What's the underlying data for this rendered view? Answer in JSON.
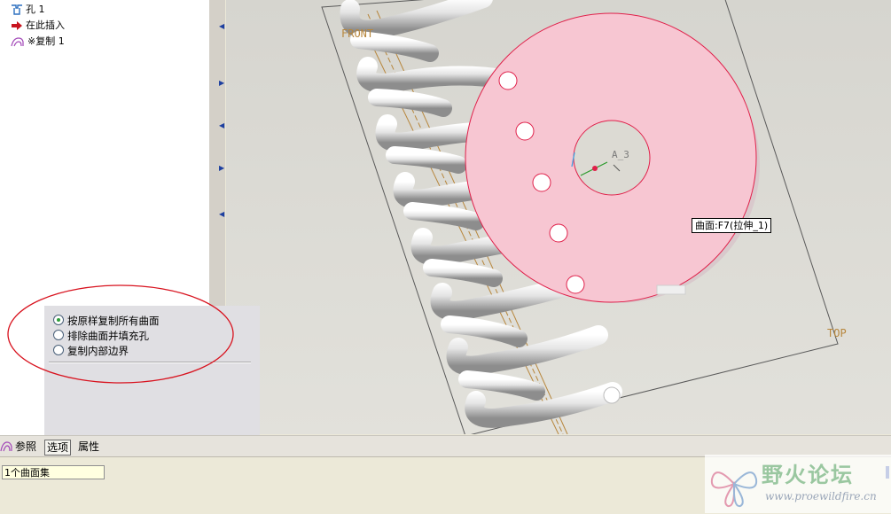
{
  "model_tree": {
    "items": [
      {
        "label": "孔 1",
        "icon": "hole-feature-icon"
      },
      {
        "label": "在此插入",
        "icon": "insert-here-arrow-icon"
      },
      {
        "label": "※复制 1",
        "icon": "copy-surface-icon"
      }
    ]
  },
  "options_panel": {
    "options": [
      {
        "label": "按原样复制所有曲面",
        "selected": true
      },
      {
        "label": "排除曲面并填充孔",
        "selected": false
      },
      {
        "label": "复制内部边界",
        "selected": false
      }
    ]
  },
  "dashboard_tabs": {
    "references": "参照",
    "options": "选项",
    "properties": "属性"
  },
  "status": {
    "selection": "1个曲面集"
  },
  "viewport": {
    "datum_front": "FRONT",
    "datum_top": "TOP",
    "axis_label": "A_3",
    "tooltip": "曲面:F7(拉伸_1)",
    "highlight_color": "#f7c6d2",
    "edge_color": "#e0204a"
  },
  "watermark": {
    "title": "野火论坛",
    "url": "www.proewildfire.cn"
  }
}
